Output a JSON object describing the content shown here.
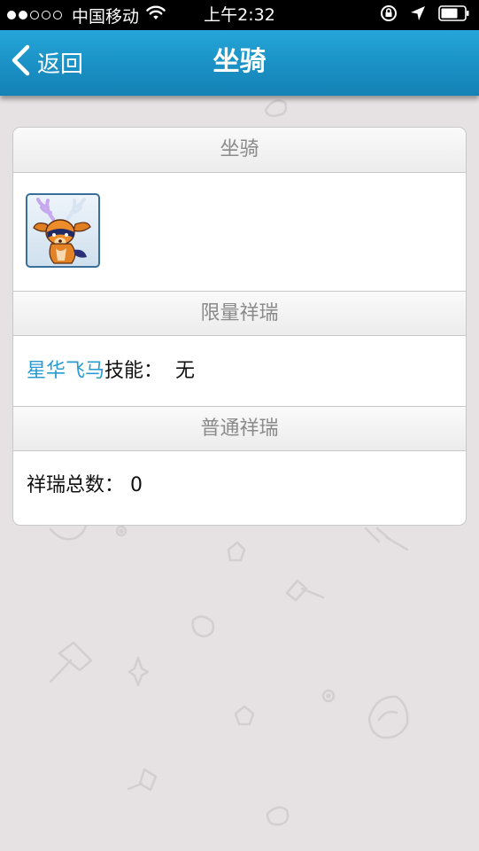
{
  "status_bar": {
    "carrier": "中国移动",
    "time": "上午2:32",
    "signal_dots_filled": 2,
    "signal_dots_total": 5
  },
  "nav": {
    "back_label": "返回",
    "title": "坐骑"
  },
  "card": {
    "mount_section_title": "坐骑",
    "limited_section_title": "限量祥瑞",
    "limited_mount_name": "星华飞马",
    "skill_label": "技能：",
    "skill_value": "无",
    "normal_section_title": "普通祥瑞",
    "total_label": "祥瑞总数：",
    "total_value": "0"
  },
  "colors": {
    "nav_blue": "#1a90c4",
    "link_blue": "#2a9bd0",
    "page_bg": "#e6e2e3"
  }
}
